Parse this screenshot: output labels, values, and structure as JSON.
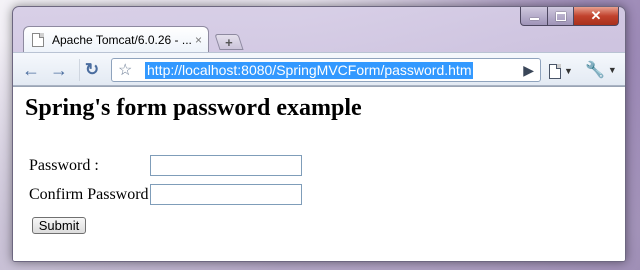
{
  "browser": {
    "tab_title": "Apache Tomcat/6.0.26 - ...",
    "tab_close": "×",
    "new_tab": "+",
    "url": "http://localhost:8080/SpringMVCForm/password.htm",
    "controls": {
      "minimize": "",
      "maximize": "",
      "close": "✕"
    },
    "icons": {
      "back": "back-arrow-icon",
      "forward": "forward-arrow-icon",
      "reload": "reload-icon",
      "bookmark": "star-icon",
      "go": "go-arrow-icon",
      "page_menu": "page-icon",
      "wrench_menu": "wrench-icon"
    },
    "accent_color": "#3399ff"
  },
  "page": {
    "heading": "Spring's form password example",
    "form": {
      "password_label": "Password :",
      "password_value": "",
      "confirm_label": "Confirm Password :",
      "confirm_value": "",
      "submit_label": "Submit"
    }
  }
}
